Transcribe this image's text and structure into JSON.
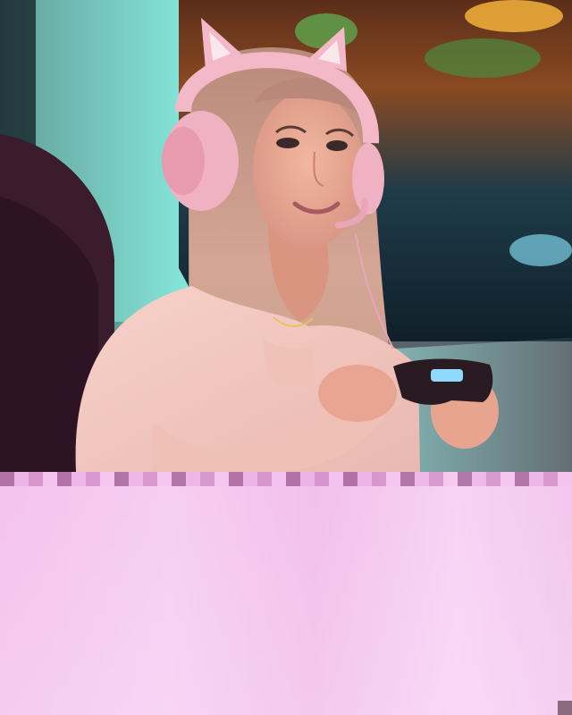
{
  "image": {
    "subject": "woman gaming",
    "colors": {
      "screen_glow": "#7fe3d6",
      "headset_pink": "#f3b9c8",
      "blouse_pink": "#f2c6bd",
      "chair": "#3a1c2d",
      "glitch_band": "#f6c9f1"
    },
    "icons": [
      "cat-ear-headset-icon",
      "game-controller-icon"
    ]
  }
}
